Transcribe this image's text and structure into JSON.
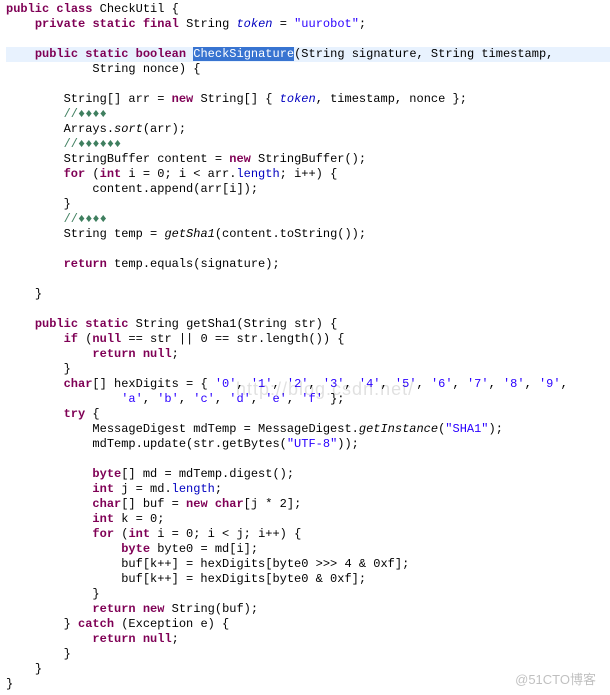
{
  "code": {
    "l1a": "public",
    "l1b": "class",
    "l1c": " CheckUtil {",
    "l2a": "private",
    "l2b": "static",
    "l2c": "final",
    "l2d": " String ",
    "l2e": "token",
    "l2f": " = ",
    "l2g": "\"uurobot\"",
    "l2h": ";",
    "l4a": "public",
    "l4b": "static",
    "l4c": "boolean",
    "l4sp": " ",
    "l4d": "CheckSignature",
    "l4e": "(String signature, String timestamp,",
    "l5a": "String nonce) {",
    "l7a": "String[] arr = ",
    "l7b": "new",
    "l7c": " String[] { ",
    "l7d": "token",
    "l7e": ", timestamp, nonce };",
    "l8a": "//♦♦♦♦",
    "l9a": "Arrays.",
    "l9b": "sort",
    "l9c": "(arr);",
    "l10a": "//♦♦♦♦♦♦",
    "l11a": "StringBuffer content = ",
    "l11b": "new",
    "l11c": " StringBuffer();",
    "l12a": "for",
    "l12b": " (",
    "l12c": "int",
    "l12d": " i = 0; i < arr.",
    "l12e": "length",
    "l12f": "; i++) {",
    "l13a": "content.append(arr[i]);",
    "l14a": "}",
    "l15a": "//♦♦♦♦",
    "l16a": "String temp = ",
    "l16b": "getSha1",
    "l16c": "(content.toString());",
    "l18a": "return",
    "l18b": " temp.equals(signature);",
    "l20a": "}",
    "l22a": "public",
    "l22b": "static",
    "l22c": " String getSha1(String str) {",
    "l23a": "if",
    "l23b": " (",
    "l23c": "null",
    "l23d": " == str || 0 == str.length()) {",
    "l24a": "return",
    "l24b": "null",
    "l24c": ";",
    "l25a": "}",
    "l26a": "char",
    "l26b": "[] hexDigits = { ",
    "l26c": "'0'",
    "l26d": ", ",
    "l26e": "'1'",
    "l26f": ", ",
    "l26g": "'2'",
    "l26h": ", ",
    "l26i": "'3'",
    "l26j": ", ",
    "l26k": "'4'",
    "l26l": ", ",
    "l26m": "'5'",
    "l26n": ", ",
    "l26o": "'6'",
    "l26p": ", ",
    "l26q": "'7'",
    "l26r": ", ",
    "l26s": "'8'",
    "l26t": ", ",
    "l26u": "'9'",
    "l26v": ",",
    "l27a": "'a'",
    "l27b": ", ",
    "l27c": "'b'",
    "l27d": ", ",
    "l27e": "'c'",
    "l27f": ", ",
    "l27g": "'d'",
    "l27h": ", ",
    "l27i": "'e'",
    "l27j": ", ",
    "l27k": "'f'",
    "l27l": " };",
    "l28a": "try",
    "l28b": " {",
    "l29a": "MessageDigest mdTemp = MessageDigest.",
    "l29b": "getInstance",
    "l29c": "(",
    "l29d": "\"SHA1\"",
    "l29e": ");",
    "l30a": "mdTemp.update(str.getBytes(",
    "l30b": "\"UTF-8\"",
    "l30c": "));",
    "l32a": "byte",
    "l32b": "[] md = mdTemp.digest();",
    "l33a": "int",
    "l33b": " j = md.",
    "l33c": "length",
    "l33d": ";",
    "l34a": "char",
    "l34b": "[] buf = ",
    "l34c": "new",
    "l34d": "char",
    "l34e": "[j * 2];",
    "l35a": "int",
    "l35b": " k = 0;",
    "l36a": "for",
    "l36b": " (",
    "l36c": "int",
    "l36d": " i = 0; i < j; i++) {",
    "l37a": "byte",
    "l37b": " byte0 = md[i];",
    "l38a": "buf[k++] = hexDigits[byte0 >>> 4 & 0xf];",
    "l39a": "buf[k++] = hexDigits[byte0 & 0xf];",
    "l40a": "}",
    "l41a": "return",
    "l41b": "new",
    "l41c": " String(buf);",
    "l42a": "} ",
    "l42b": "catch",
    "l42c": " (Exception e) {",
    "l43a": "return",
    "l43b": "null",
    "l43c": ";",
    "l44a": "}",
    "l45a": "}",
    "l46a": "}"
  },
  "watermark1": "http://blog.csdn.net/",
  "watermark2": "@51CTO博客"
}
